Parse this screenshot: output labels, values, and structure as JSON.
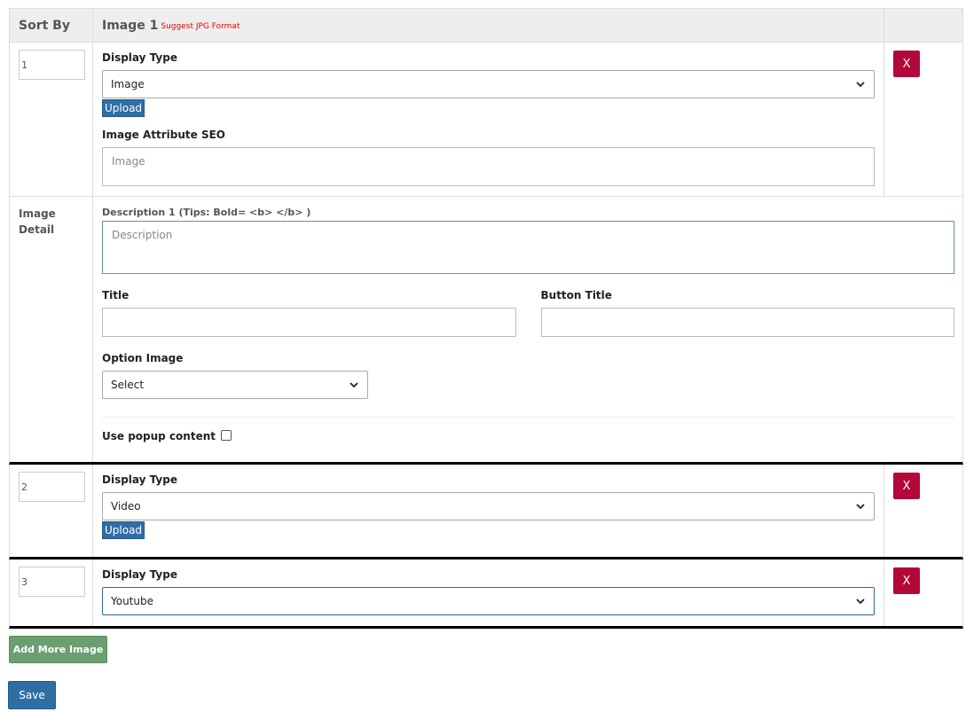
{
  "header": {
    "sort_by": "Sort By",
    "image_col": "Image 1",
    "image_note": "Suggest JPG Format"
  },
  "items": [
    {
      "sort_value": "1",
      "display_type_label": "Display Type",
      "display_type_value": "Image",
      "upload_label": "Upload",
      "seo_label": "Image Attribute SEO",
      "seo_placeholder": "Image",
      "remove_label": "X"
    },
    {
      "sort_value": "2",
      "display_type_label": "Display Type",
      "display_type_value": "Video",
      "upload_label": "Upload",
      "remove_label": "X"
    },
    {
      "sort_value": "3",
      "display_type_label": "Display Type",
      "display_type_value": "Youtube",
      "remove_label": "X"
    }
  ],
  "detail": {
    "side_label": "Image Detail",
    "description_label": "Description 1 (Tips: Bold= <b> </b> )",
    "description_placeholder": "Description",
    "title_label": "Title",
    "button_title_label": "Button Title",
    "option_image_label": "Option Image",
    "option_image_value": "Select",
    "popup_label": "Use popup content",
    "popup_checked": false
  },
  "actions": {
    "add_more": "Add More Image",
    "save": "Save"
  },
  "colors": {
    "remove_button": "#b3083a",
    "upload_button": "#2f6ea5",
    "add_button": "#6b9e71",
    "note_red": "#e00000"
  }
}
